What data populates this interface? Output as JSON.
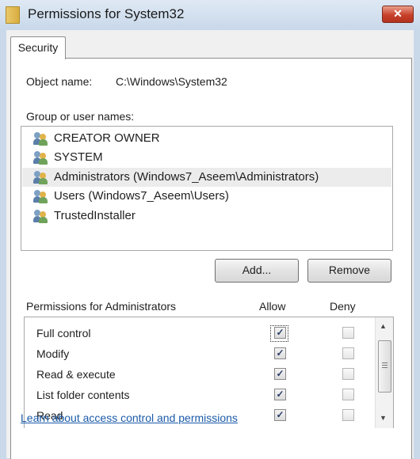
{
  "window": {
    "title": "Permissions for System32",
    "close_label": "✕"
  },
  "tabs": [
    {
      "label": "Security"
    }
  ],
  "object": {
    "label": "Object name:",
    "value": "C:\\Windows\\System32"
  },
  "group": {
    "label": "Group or user names:",
    "users": [
      {
        "name": "CREATOR OWNER"
      },
      {
        "name": "SYSTEM"
      },
      {
        "name": "Administrators (Windows7_Aseem\\Administrators)"
      },
      {
        "name": "Users (Windows7_Aseem\\Users)"
      },
      {
        "name": "TrustedInstaller"
      }
    ],
    "selected_user": "Administrators (Windows7_Aseem\\Administrators)"
  },
  "buttons": {
    "add": "Add...",
    "remove": "Remove"
  },
  "permissions": {
    "header": "Permissions for Administrators",
    "allow_header": "Allow",
    "deny_header": "Deny",
    "rows": [
      {
        "name": "Full control",
        "allow": "✓",
        "deny": ""
      },
      {
        "name": "Modify",
        "allow": "✓",
        "deny": ""
      },
      {
        "name": "Read & execute",
        "allow": "✓",
        "deny": ""
      },
      {
        "name": "List folder contents",
        "allow": "✓",
        "deny": ""
      },
      {
        "name": "Read",
        "allow": "✓",
        "deny": ""
      }
    ]
  },
  "icons": {
    "folder": "folder-icon",
    "user_group": "user-group-icon",
    "scroll_up": "▲",
    "scroll_down": "▼"
  },
  "link": "Learn about access control and permissions"
}
